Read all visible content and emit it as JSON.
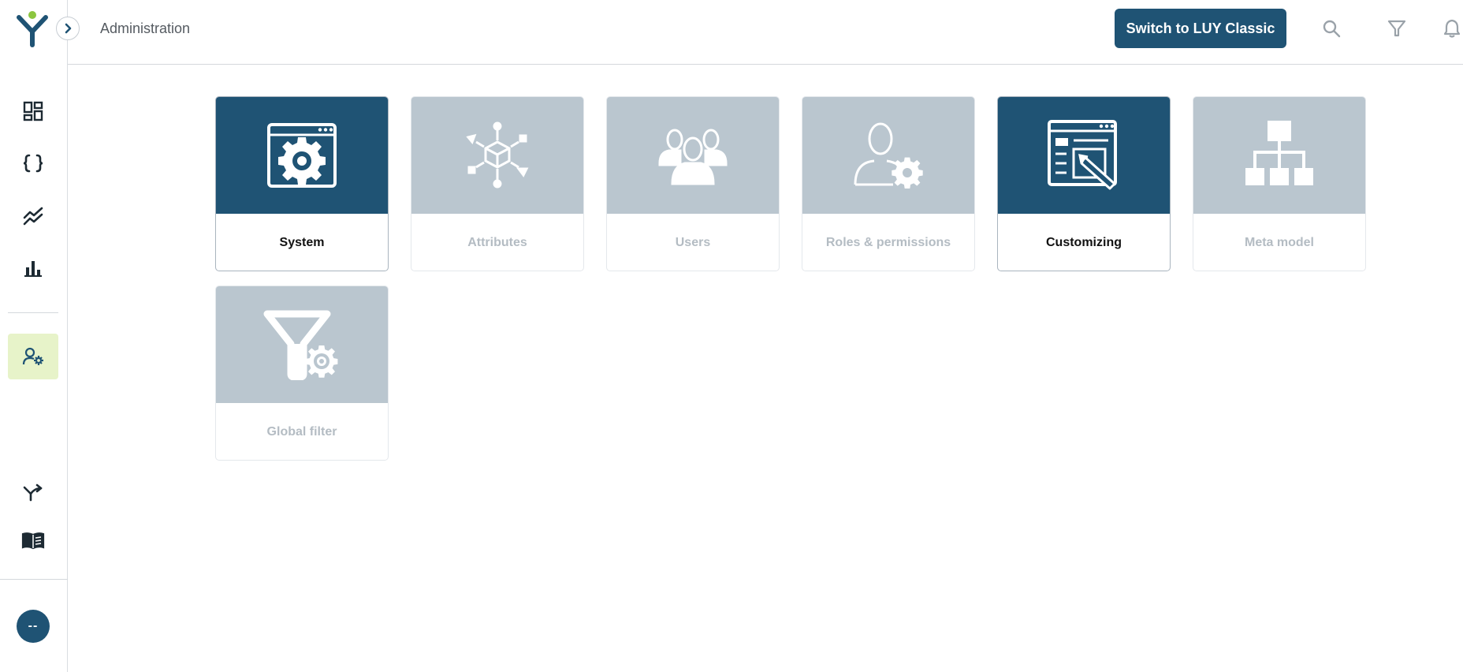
{
  "header": {
    "title": "Administration",
    "switch_button": "Switch to LUY Classic",
    "icons": [
      "search-icon",
      "filter-icon",
      "bell-icon"
    ]
  },
  "sidebar": {
    "items": [
      {
        "icon": "dashboard-icon",
        "active": false
      },
      {
        "icon": "curly-braces-icon",
        "active": false
      },
      {
        "icon": "trend-lines-icon",
        "active": false
      },
      {
        "icon": "bar-chart-icon",
        "active": false
      },
      {
        "icon": "user-gear-icon",
        "active": true
      },
      {
        "icon": "merge-arrow-icon",
        "active": false
      },
      {
        "icon": "open-book-icon",
        "active": false
      }
    ],
    "avatar_initials": "--"
  },
  "tiles": [
    {
      "label": "System",
      "icon": "window-gear-icon",
      "enabled": true
    },
    {
      "label": "Attributes",
      "icon": "cube-network-icon",
      "enabled": false
    },
    {
      "label": "Users",
      "icon": "user-group-icon",
      "enabled": false
    },
    {
      "label": "Roles & permissions",
      "icon": "user-gear-icon",
      "enabled": false
    },
    {
      "label": "Customizing",
      "icon": "window-pencil-icon",
      "enabled": true
    },
    {
      "label": "Meta model",
      "icon": "hierarchy-icon",
      "enabled": false
    },
    {
      "label": "Global filter",
      "icon": "filter-gear-icon",
      "enabled": false
    }
  ],
  "colors": {
    "primary": "#1f5374",
    "tile_disabled": "#bac6cf",
    "active_nav_bg": "#e7f3c9",
    "logo_green": "#8cc63f"
  }
}
